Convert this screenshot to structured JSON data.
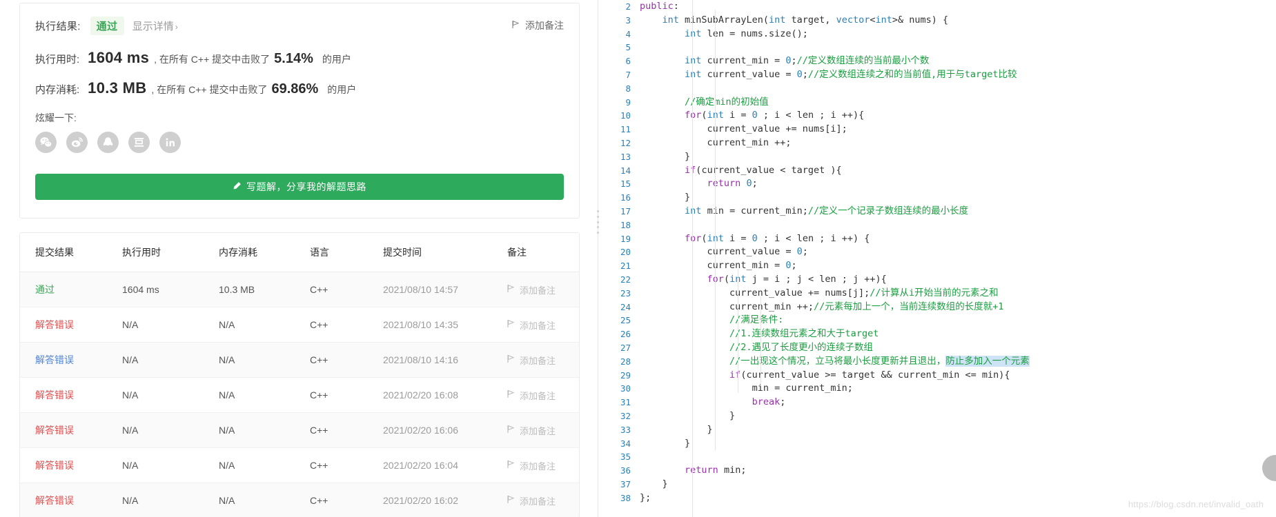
{
  "submission_panel": {
    "result_label": "执行结果:",
    "result_status": "通过",
    "detail_link": "显示详情",
    "detail_chevron": "›",
    "add_note_top": "添加备注",
    "runtime": {
      "label": "执行用时:",
      "value": "1604 ms",
      "tail_prefix": ", 在所有 C++ 提交中击败了",
      "percent": "5.14%",
      "tail_suffix": "的用户"
    },
    "memory": {
      "label": "内存消耗:",
      "value": "10.3 MB",
      "tail_prefix": ", 在所有 C++ 提交中击败了",
      "percent": "69.86%",
      "tail_suffix": "的用户"
    },
    "share_label": "炫耀一下:",
    "share_icons": [
      {
        "name": "wechat-icon",
        "title": "微信"
      },
      {
        "name": "weibo-icon",
        "title": "微博"
      },
      {
        "name": "qq-icon",
        "title": "QQ"
      },
      {
        "name": "douban-icon",
        "title": "豆瓣"
      },
      {
        "name": "linkedin-icon",
        "title": "LinkedIn"
      }
    ],
    "write_button": "写题解，分享我的解题思路",
    "write_button_icon": "pencil-icon",
    "accent_green": "#2eaa5d",
    "pass_green": "#3aa757",
    "error_red": "#e34d4d"
  },
  "submissions_table": {
    "columns": [
      "提交结果",
      "执行用时",
      "内存消耗",
      "语言",
      "提交时间",
      "备注"
    ],
    "note_placeholder": "添加备注",
    "rows": [
      {
        "status": "通过",
        "status_color": "pass",
        "runtime": "1604 ms",
        "memory": "10.3 MB",
        "language": "C++",
        "time": "2021/08/10 14:57",
        "note": "添加备注"
      },
      {
        "status": "解答错误",
        "status_color": "error",
        "runtime": "N/A",
        "memory": "N/A",
        "language": "C++",
        "time": "2021/08/10 14:35",
        "note": "添加备注"
      },
      {
        "status": "解答错误",
        "status_color": "link",
        "runtime": "N/A",
        "memory": "N/A",
        "language": "C++",
        "time": "2021/08/10 14:16",
        "note": "添加备注"
      },
      {
        "status": "解答错误",
        "status_color": "error",
        "runtime": "N/A",
        "memory": "N/A",
        "language": "C++",
        "time": "2021/02/20 16:08",
        "note": "添加备注"
      },
      {
        "status": "解答错误",
        "status_color": "error",
        "runtime": "N/A",
        "memory": "N/A",
        "language": "C++",
        "time": "2021/02/20 16:06",
        "note": "添加备注"
      },
      {
        "status": "解答错误",
        "status_color": "error",
        "runtime": "N/A",
        "memory": "N/A",
        "language": "C++",
        "time": "2021/02/20 16:04",
        "note": "添加备注"
      },
      {
        "status": "解答错误",
        "status_color": "error",
        "runtime": "N/A",
        "memory": "N/A",
        "language": "C++",
        "time": "2021/02/20 16:02",
        "note": "添加备注"
      }
    ]
  },
  "code_editor": {
    "language": "C++",
    "first_visible_line": 2,
    "last_visible_line": 38,
    "watermark": "https://blog.csdn.net/invalid_oath",
    "selection_line": 28,
    "selection_text": "防止多加入一个元素",
    "lines": [
      {
        "n": 2,
        "code": "public:"
      },
      {
        "n": 3,
        "code": "    int minSubArrayLen(int target, vector<int>& nums) {"
      },
      {
        "n": 4,
        "code": "        int len = nums.size();"
      },
      {
        "n": 5,
        "code": ""
      },
      {
        "n": 6,
        "code": "        int current_min = 0;//定义数组连续的当前最小个数"
      },
      {
        "n": 7,
        "code": "        int current_value = 0;//定义数组连续之和的当前值,用于与target比较"
      },
      {
        "n": 8,
        "code": ""
      },
      {
        "n": 9,
        "code": "        //确定min的初始值"
      },
      {
        "n": 10,
        "code": "        for(int i = 0 ; i < len ; i ++){"
      },
      {
        "n": 11,
        "code": "            current_value += nums[i];"
      },
      {
        "n": 12,
        "code": "            current_min ++;"
      },
      {
        "n": 13,
        "code": "        }"
      },
      {
        "n": 14,
        "code": "        if(current_value < target ){"
      },
      {
        "n": 15,
        "code": "            return 0;"
      },
      {
        "n": 16,
        "code": "        }"
      },
      {
        "n": 17,
        "code": "        int min = current_min;//定义一个记录子数组连续的最小长度"
      },
      {
        "n": 18,
        "code": ""
      },
      {
        "n": 19,
        "code": "        for(int i = 0 ; i < len ; i ++) {"
      },
      {
        "n": 20,
        "code": "            current_value = 0;"
      },
      {
        "n": 21,
        "code": "            current_min = 0;"
      },
      {
        "n": 22,
        "code": "            for(int j = i ; j < len ; j ++){"
      },
      {
        "n": 23,
        "code": "                current_value += nums[j];//计算从i开始当前的元素之和"
      },
      {
        "n": 24,
        "code": "                current_min ++;//元素每加上一个，当前连续数组的长度就+1"
      },
      {
        "n": 25,
        "code": "                //满足条件:"
      },
      {
        "n": 26,
        "code": "                //1.连续数组元素之和大于target"
      },
      {
        "n": 27,
        "code": "                //2.遇见了长度更小的连续子数组"
      },
      {
        "n": 28,
        "code": "                //一出现这个情况，立马将最小长度更新并且退出，防止多加入一个元素"
      },
      {
        "n": 29,
        "code": "                if(current_value >= target && current_min <= min){"
      },
      {
        "n": 30,
        "code": "                    min = current_min;"
      },
      {
        "n": 31,
        "code": "                    break;"
      },
      {
        "n": 32,
        "code": "                }"
      },
      {
        "n": 33,
        "code": "            }"
      },
      {
        "n": 34,
        "code": "        }"
      },
      {
        "n": 35,
        "code": ""
      },
      {
        "n": 36,
        "code": "        return min;"
      },
      {
        "n": 37,
        "code": "    }"
      },
      {
        "n": 38,
        "code": "};"
      }
    ]
  }
}
